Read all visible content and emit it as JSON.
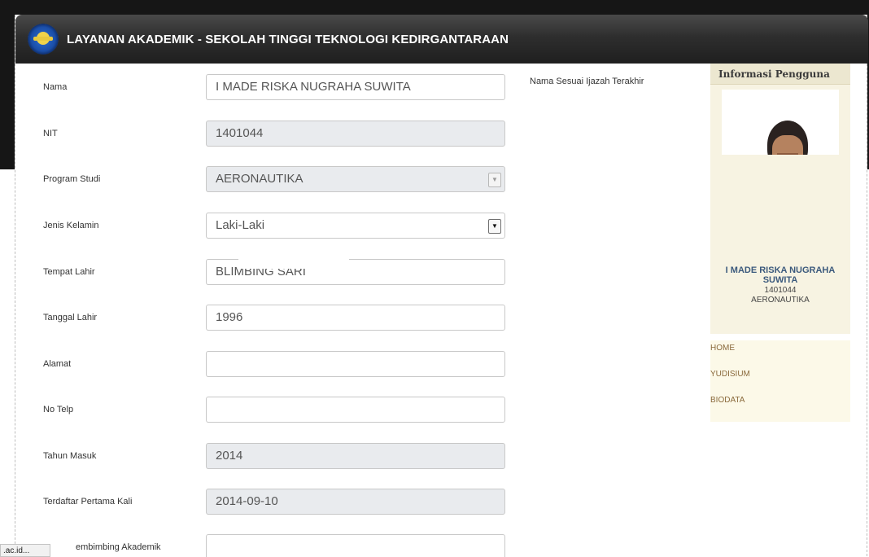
{
  "header": {
    "title": "LAYANAN AKADEMIK - SEKOLAH TINGGI TEKNOLOGI KEDIRGANTARAAN"
  },
  "form": {
    "nama": {
      "label": "Nama",
      "value": "I MADE RISKA NUGRAHA SUWITA",
      "hint": "Nama Sesuai Ijazah Terakhir"
    },
    "nit": {
      "label": "NIT",
      "value": "1401044"
    },
    "program_studi": {
      "label": "Program Studi",
      "value": "AERONAUTIKA"
    },
    "jenis_kelamin": {
      "label": "Jenis Kelamin",
      "value": "Laki-Laki"
    },
    "tempat_lahir": {
      "label": "Tempat Lahir",
      "value": "BLIMBING SARI"
    },
    "tanggal_lahir": {
      "label": "Tanggal Lahir",
      "value": "1996"
    },
    "alamat": {
      "label": "Alamat",
      "value": ""
    },
    "no_telp": {
      "label": "No Telp",
      "value": ""
    },
    "tahun_masuk": {
      "label": "Tahun Masuk",
      "value": "2014"
    },
    "terdaftar": {
      "label": "Terdaftar Pertama Kali",
      "value": "2014-09-10"
    },
    "pembimbing": {
      "label": "embimbing Akademik",
      "value": ""
    }
  },
  "sidebar": {
    "info_title": "Informasi Pengguna",
    "user_name": "I MADE RISKA NUGRAHA SUWITA",
    "user_nit": "1401044",
    "user_prodi": "AERONAUTIKA",
    "menu": [
      {
        "label": "HOME"
      },
      {
        "label": "YUDISIUM"
      },
      {
        "label": "BIODATA"
      }
    ]
  },
  "status_bar": {
    "text": ".ac.id..."
  },
  "colors": {
    "header_bg": "#2e2e2e",
    "sidebar_bg": "#f7f3e2",
    "readonly_bg": "#e9ebee",
    "menu_link": "#8a6a3c",
    "user_name": "#3c5a7d"
  }
}
